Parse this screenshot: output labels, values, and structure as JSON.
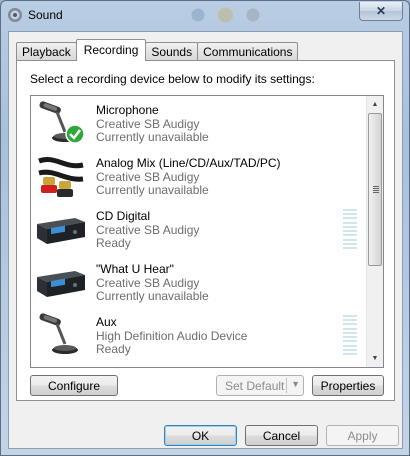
{
  "window": {
    "title": "Sound",
    "close_label": "✕"
  },
  "tabs": [
    {
      "label": "Playback",
      "active": false
    },
    {
      "label": "Recording",
      "active": true
    },
    {
      "label": "Sounds",
      "active": false
    },
    {
      "label": "Communications",
      "active": false
    }
  ],
  "instruction": "Select a recording device below to modify its settings:",
  "devices": [
    {
      "name": "Microphone",
      "driver": "Creative SB Audigy",
      "status": "Currently unavailable",
      "icon": "microphone-default-icon",
      "level_meter": false
    },
    {
      "name": "Analog Mix (Line/CD/Aux/TAD/PC)",
      "driver": "Creative SB Audigy",
      "status": "Currently unavailable",
      "icon": "rca-cable-icon",
      "level_meter": false
    },
    {
      "name": "CD Digital",
      "driver": "Creative SB Audigy",
      "status": "Ready",
      "icon": "audio-device-icon",
      "level_meter": true
    },
    {
      "name": "\"What U Hear\"",
      "driver": "Creative SB Audigy",
      "status": "Currently unavailable",
      "icon": "audio-device-icon",
      "level_meter": false
    },
    {
      "name": "Aux",
      "driver": "High Definition Audio Device",
      "status": "Ready",
      "icon": "microphone-icon",
      "level_meter": true
    }
  ],
  "buttons": {
    "configure": "Configure",
    "set_default": "Set Default",
    "set_default_arrow": "▼",
    "properties": "Properties",
    "ok": "OK",
    "cancel": "Cancel",
    "apply": "Apply"
  },
  "scrollbar": {
    "up": "▲",
    "down": "▼"
  },
  "colors": {
    "default_check": "#2fa83a",
    "level_meter": "#cfe7ec",
    "window_frame": "#a9c0da"
  }
}
